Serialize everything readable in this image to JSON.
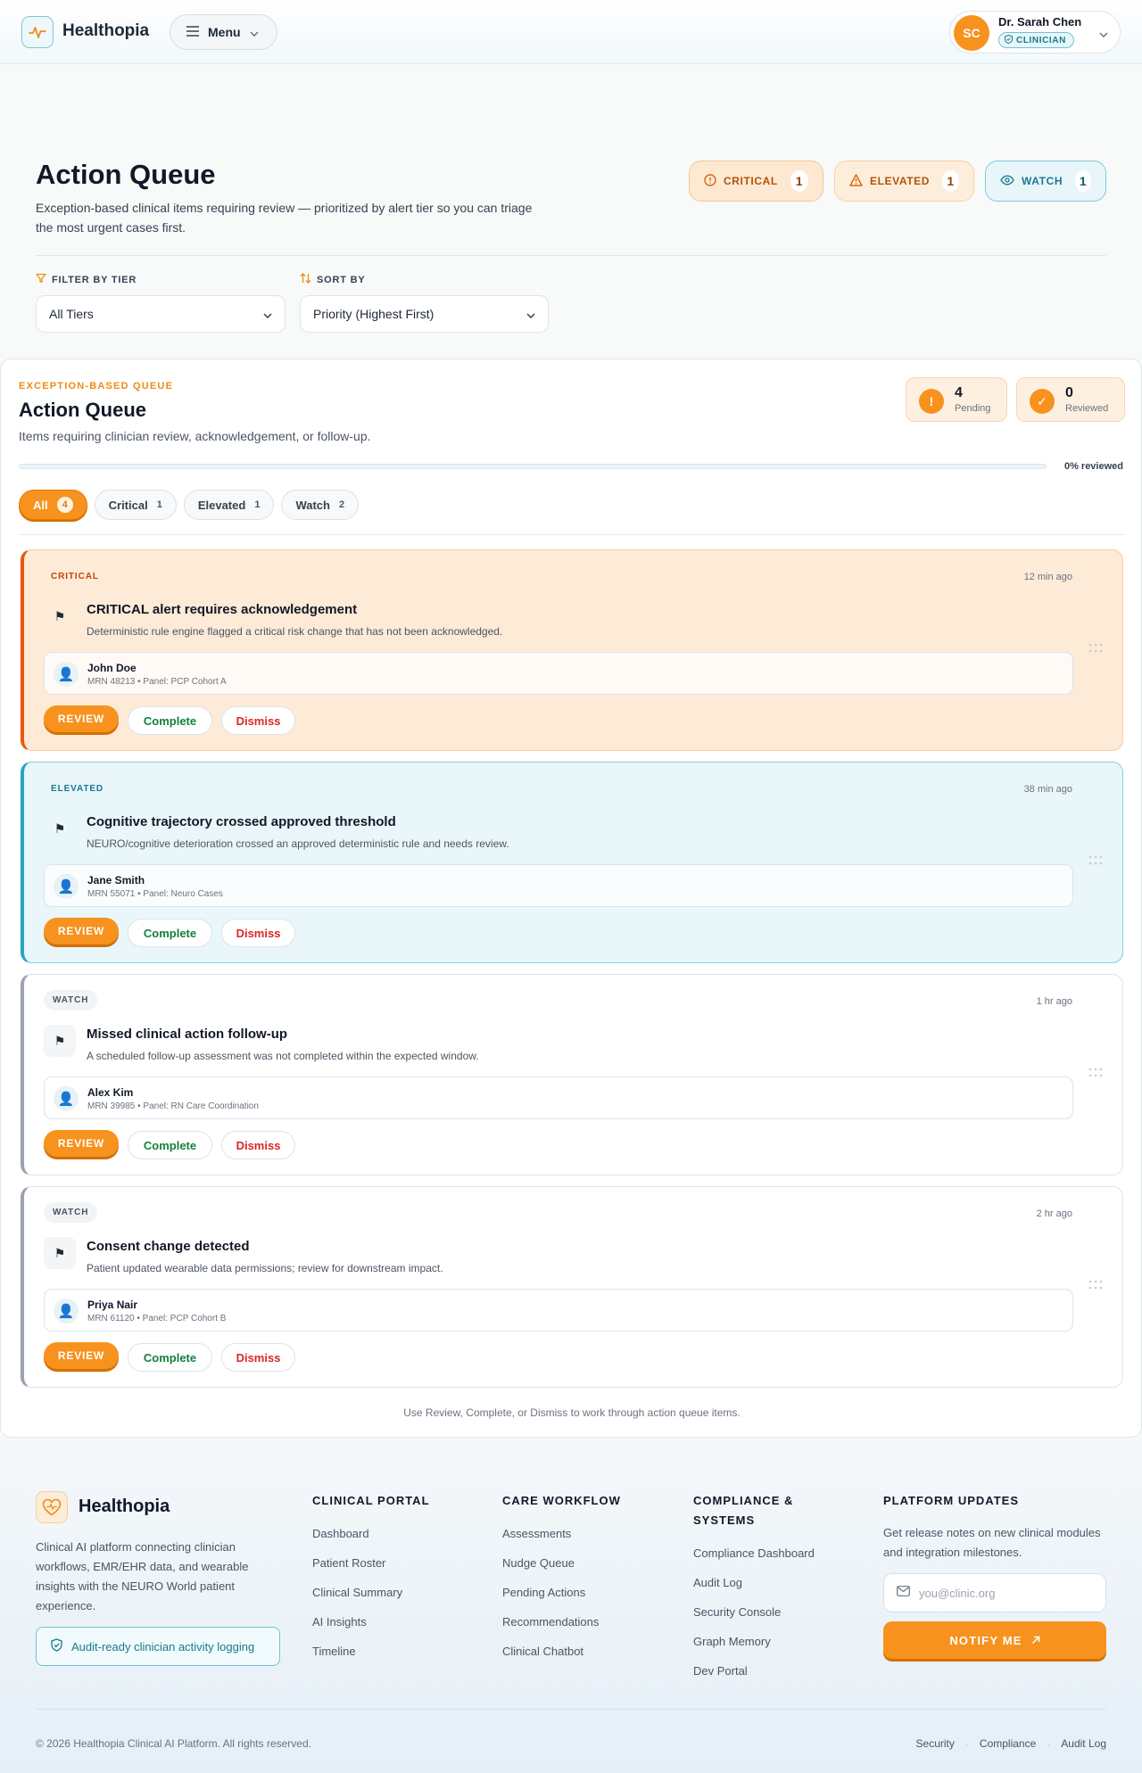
{
  "header": {
    "brand": "Healthopia",
    "menu_label": "Menu",
    "user": {
      "initials": "SC",
      "name": "Dr. Sarah Chen",
      "role": "CLINICIAN"
    }
  },
  "page": {
    "title": "Action Queue",
    "subtitle": "Exception-based clinical items requiring review — prioritized by alert tier so you can triage the most urgent cases first.",
    "tier_chips": [
      {
        "label": "CRITICAL",
        "count": "1"
      },
      {
        "label": "ELEVATED",
        "count": "1"
      },
      {
        "label": "WATCH",
        "count": "1"
      }
    ],
    "filter": {
      "label": "FILTER BY TIER",
      "value": "All Tiers"
    },
    "sort": {
      "label": "SORT BY",
      "value": "Priority (Highest First)"
    }
  },
  "queue": {
    "eyebrow": "EXCEPTION-BASED QUEUE",
    "title": "Action Queue",
    "subtitle": "Items requiring clinician review, acknowledgement, or follow-up.",
    "pending": {
      "count": "4",
      "label": "Pending",
      "icon": "!"
    },
    "reviewed": {
      "count": "0",
      "label": "Reviewed",
      "icon": "✓"
    },
    "progress_percent": 0,
    "progress_label": "0% reviewed",
    "tabs": [
      {
        "label": "All",
        "count": "4"
      },
      {
        "label": "Critical",
        "count": "1"
      },
      {
        "label": "Elevated",
        "count": "1"
      },
      {
        "label": "Watch",
        "count": "2"
      }
    ],
    "items": [
      {
        "tier": "CRITICAL",
        "time": "12 min ago",
        "title": "CRITICAL alert requires acknowledgement",
        "description": "Deterministic rule engine flagged a critical risk change that has not been acknowledged.",
        "patient_name": "John Doe",
        "patient_meta": "MRN 48213 • Panel: PCP Cohort A"
      },
      {
        "tier": "ELEVATED",
        "time": "38 min ago",
        "title": "Cognitive trajectory crossed approved threshold",
        "description": "NEURO/cognitive deterioration crossed an approved deterministic rule and needs review.",
        "patient_name": "Jane Smith",
        "patient_meta": "MRN 55071 • Panel: Neuro Cases"
      },
      {
        "tier": "WATCH",
        "time": "1 hr ago",
        "title": "Missed clinical action follow-up",
        "description": "A scheduled follow-up assessment was not completed within the expected window.",
        "patient_name": "Alex Kim",
        "patient_meta": "MRN 39985 • Panel: RN Care Coordination"
      },
      {
        "tier": "WATCH",
        "time": "2 hr ago",
        "title": "Consent change detected",
        "description": "Patient updated wearable data permissions; review for downstream impact.",
        "patient_name": "Priya Nair",
        "patient_meta": "MRN 61120 • Panel: PCP Cohort B"
      }
    ],
    "actions": {
      "review": "REVIEW",
      "complete": "Complete",
      "dismiss": "Dismiss"
    },
    "footer_note": "Use Review, Complete, or Dismiss to work through action queue items."
  },
  "footer": {
    "brand": "Healthopia",
    "about": "Clinical AI platform connecting clinician workflows, EMR/EHR data, and wearable insights with the NEURO World patient experience.",
    "audit_badge": "Audit-ready clinician activity logging",
    "columns": [
      {
        "title": "CLINICAL PORTAL",
        "links": [
          "Dashboard",
          "Patient Roster",
          "Clinical Summary",
          "AI Insights",
          "Timeline"
        ]
      },
      {
        "title": "CARE WORKFLOW",
        "links": [
          "Assessments",
          "Nudge Queue",
          "Pending Actions",
          "Recommendations",
          "Clinical Chatbot"
        ]
      },
      {
        "title": "COMPLIANCE & SYSTEMS",
        "links": [
          "Compliance Dashboard",
          "Audit Log",
          "Security Console",
          "Graph Memory",
          "Dev Portal"
        ]
      }
    ],
    "updates": {
      "title": "PLATFORM UPDATES",
      "text": "Get release notes on new clinical modules and integration milestones.",
      "placeholder": "you@clinic.org",
      "button": "NOTIFY ME"
    },
    "copyright": "© 2026 Healthopia Clinical AI Platform. All rights reserved.",
    "legal": [
      "Security",
      "Compliance",
      "Audit Log"
    ]
  },
  "colors": {
    "accent": "#f7921e",
    "teal": "#17798e",
    "critical": "#ea580c",
    "elevated": "#2aa5bf",
    "watch": "#9ca3af"
  }
}
